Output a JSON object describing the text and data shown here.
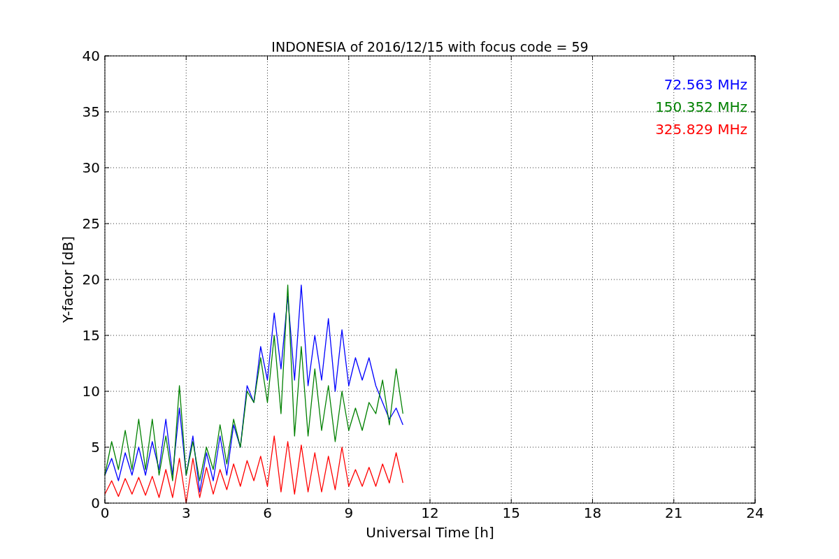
{
  "chart_data": {
    "type": "line",
    "title": "INDONESIA of 2016/12/15 with focus code = 59",
    "xlabel": "Universal Time [h]",
    "ylabel": "Y-factor [dB]",
    "x": [
      0,
      0.25,
      0.5,
      0.75,
      1,
      1.25,
      1.5,
      1.75,
      2,
      2.25,
      2.5,
      2.75,
      3,
      3.25,
      3.5,
      3.75,
      4,
      4.25,
      4.5,
      4.75,
      5,
      5.25,
      5.5,
      5.75,
      6,
      6.25,
      6.5,
      6.75,
      7,
      7.25,
      7.5,
      7.75,
      8,
      8.25,
      8.5,
      8.75,
      9,
      9.25,
      9.5,
      9.75,
      10,
      10.25,
      10.5,
      10.75,
      11
    ],
    "series": [
      {
        "name": "72.563 MHz",
        "color": "#0000ff",
        "values": [
          2.5,
          4,
          2,
          4.5,
          2.5,
          5,
          2.5,
          5.5,
          3,
          7.5,
          2.5,
          8.5,
          2.5,
          6,
          1,
          4.5,
          2,
          6,
          2.5,
          7,
          5,
          10.5,
          9,
          14,
          11,
          17,
          12,
          18.5,
          11,
          19.5,
          10.5,
          15,
          11,
          16.5,
          10,
          15.5,
          10.5,
          13,
          11,
          13,
          10.5,
          9,
          7.5,
          8.5,
          7
        ]
      },
      {
        "name": "150.352 MHz",
        "color": "#008000",
        "values": [
          2.5,
          5.5,
          3,
          6.5,
          3,
          7.5,
          3,
          7.5,
          2.5,
          6,
          2,
          10.5,
          2.5,
          5.5,
          2,
          5,
          3,
          7,
          3.5,
          7.5,
          5,
          10,
          9,
          13,
          9,
          15,
          8,
          19.5,
          6,
          14,
          6,
          12,
          6.5,
          10.5,
          5.5,
          10,
          6.5,
          8.5,
          6.5,
          9,
          8,
          11,
          7,
          12,
          8
        ]
      },
      {
        "name": "325.829 MHz",
        "color": "#ff0000",
        "values": [
          0.8,
          2,
          0.6,
          2.2,
          0.8,
          2.3,
          0.7,
          2.4,
          0.5,
          3,
          0.5,
          4,
          0,
          4,
          0.5,
          3.2,
          0.8,
          3,
          1.2,
          3.5,
          1.5,
          3.8,
          2,
          4.2,
          1.5,
          6,
          1,
          5.5,
          0.8,
          5.2,
          1,
          4.5,
          1,
          4.2,
          1.2,
          5,
          1.5,
          3,
          1.5,
          3.2,
          1.5,
          3.5,
          1.8,
          4.5,
          1.8
        ]
      }
    ],
    "xlim": [
      0,
      24
    ],
    "ylim": [
      0,
      40
    ],
    "xticks": [
      0,
      3,
      6,
      9,
      12,
      15,
      18,
      21,
      24
    ],
    "yticks": [
      0,
      5,
      10,
      15,
      20,
      25,
      30,
      35,
      40
    ],
    "grid": true
  }
}
